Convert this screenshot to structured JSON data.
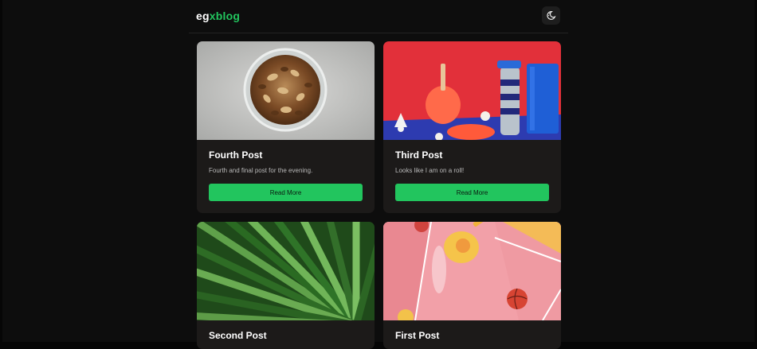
{
  "brand": {
    "part1": "eg",
    "part2": "xblog"
  },
  "header": {
    "theme_toggle_icon": "moon-sun-icon"
  },
  "posts": [
    {
      "title": "Fourth Post",
      "description": "Fourth and final post for the evening.",
      "button": "Read More",
      "image": "bowl-of-nuts"
    },
    {
      "title": "Third Post",
      "description": "Looks like I am on a roll!",
      "button": "Read More",
      "image": "table-tennis-items"
    },
    {
      "title": "Second Post",
      "description": "",
      "button": "",
      "image": "green-palm-leaf"
    },
    {
      "title": "First Post",
      "description": "",
      "button": "",
      "image": "pink-court-balls"
    }
  ],
  "colors": {
    "accent": "#22c55e",
    "card": "#1c1a19",
    "background": "#0d0d0d"
  }
}
